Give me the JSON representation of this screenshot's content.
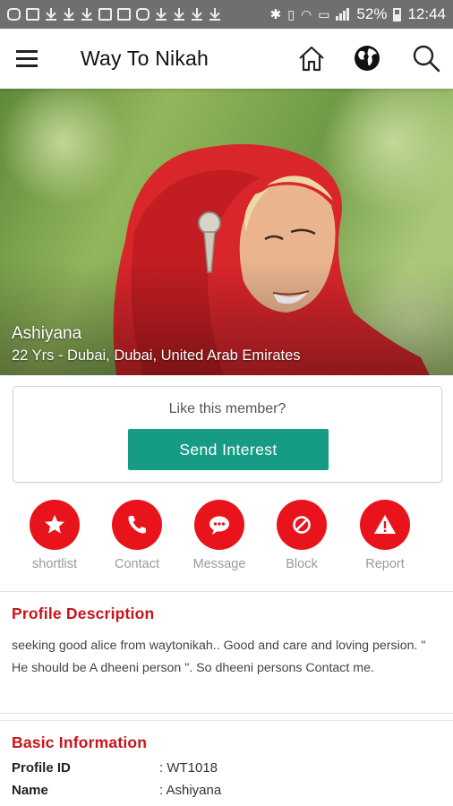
{
  "status_bar": {
    "battery": "52%",
    "time": "12:44",
    "left_icons": [
      "chat-icon",
      "image-icon",
      "download-icon",
      "download-icon",
      "download-icon",
      "bag-icon",
      "news-icon",
      "instagram-icon",
      "download-icon",
      "download-icon",
      "download-icon",
      "download-icon"
    ],
    "right_icons": [
      "bluetooth-icon",
      "vibrate-icon",
      "wifi-icon",
      "sim-icon",
      "signal-icon",
      "battery-icon"
    ]
  },
  "app_bar": {
    "title": "Way To Nikah",
    "icons": [
      "menu-icon",
      "home-icon",
      "globe-icon",
      "search-icon"
    ]
  },
  "profile": {
    "name": "Ashiyana",
    "subtitle": "22 Yrs - Dubai, Dubai, United Arab Emirates"
  },
  "like_card": {
    "question": "Like this member?",
    "button_label": "Send Interest"
  },
  "actions": [
    {
      "label": "shortlist",
      "icon": "star-icon"
    },
    {
      "label": "Contact",
      "icon": "phone-icon"
    },
    {
      "label": "Message",
      "icon": "chat-bubble-icon"
    },
    {
      "label": "Block",
      "icon": "block-icon"
    },
    {
      "label": "Report",
      "icon": "warning-icon"
    }
  ],
  "description": {
    "title": "Profile Description",
    "text": "seeking good alice from waytonikah.. Good and care and loving persion. \" He should be A dheeni person \". So dheeni persons Contact me."
  },
  "basic_info": {
    "title": "Basic Information",
    "rows": [
      {
        "key": "Profile ID",
        "value": ": WT1018"
      },
      {
        "key": "Name",
        "value": ": Ashiyana"
      }
    ]
  },
  "colors": {
    "accent_red": "#e8131b",
    "section_title_red": "#c8141c",
    "button_teal": "#169b85",
    "status_bar": "#6f6f6f"
  }
}
